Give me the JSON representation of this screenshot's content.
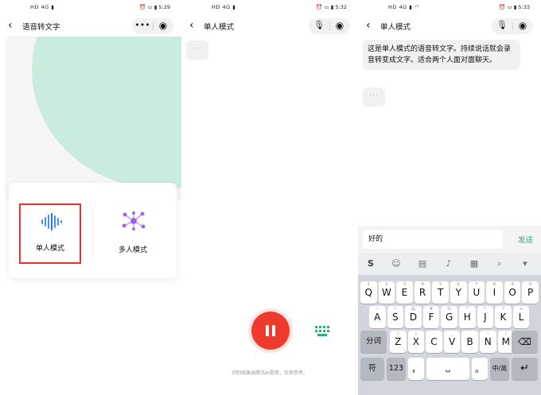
{
  "panels": [
    {
      "status": {
        "left": "HD 4G ▮",
        "right": "⏰ ▭ ▮ 5:29"
      },
      "nav": {
        "title": "语音转文字",
        "back_icon": "chevron-left-icon",
        "more_icon": "more-dots-icon",
        "close_icon": "record-target-icon"
      },
      "modes": [
        {
          "label": "单人模式",
          "icon": "soundwave-icon",
          "selected": true
        },
        {
          "label": "多人模式",
          "icon": "network-nodes-icon",
          "selected": false
        }
      ]
    },
    {
      "status": {
        "left": "HD 4G ▮",
        "right": "⏰ ▭ ▮ 5:32"
      },
      "nav": {
        "title": "单人模式",
        "mic_icon": "microphone-icon",
        "close_icon": "record-target-icon"
      },
      "typing_indicator": "...",
      "pause_button": "pause-icon",
      "keyboard_button": "keyboard-icon",
      "footnote": "识别结果由腾讯AI提供，仅供参考。"
    },
    {
      "status": {
        "left": "HD 4G ▮ ◠",
        "right": "⏰ ▭ ▮ 5:33"
      },
      "nav": {
        "title": "单人模式",
        "mic_icon": "microphone-icon",
        "close_icon": "record-target-icon"
      },
      "message": "这是单人模式的语音转文字。持续说话就会录音转变成文字。适合两个人面对面聊天。",
      "typing_indicator": "...",
      "input": {
        "value": "好的",
        "send_label": "发送"
      },
      "keyboard": {
        "toolbar_icons": [
          "sogou-logo-icon",
          "emoji-icon",
          "clipboard-icon",
          "microphone-icon",
          "apps-grid-icon",
          "search-icon",
          "collapse-icon"
        ],
        "row1": [
          [
            "Q",
            "1"
          ],
          [
            "W",
            "2"
          ],
          [
            "E",
            "3"
          ],
          [
            "R",
            "4"
          ],
          [
            "T",
            "5"
          ],
          [
            "Y",
            "6"
          ],
          [
            "U",
            "7"
          ],
          [
            "I",
            "8"
          ],
          [
            "O",
            "9"
          ],
          [
            "P",
            "0"
          ]
        ],
        "row2": [
          [
            "A",
            "~"
          ],
          [
            "S",
            "!"
          ],
          [
            "D",
            "@"
          ],
          [
            "F",
            "#"
          ],
          [
            "G",
            "%"
          ],
          [
            "H",
            "\""
          ],
          [
            "J",
            "*"
          ],
          [
            "K",
            "?"
          ],
          [
            "L",
            "+"
          ]
        ],
        "row3": [
          [
            "Z",
            "("
          ],
          [
            "X",
            ")"
          ],
          [
            "C",
            "-"
          ],
          [
            "V",
            "_"
          ],
          [
            "B",
            ":"
          ],
          [
            "N",
            ";"
          ],
          [
            "M",
            "/"
          ]
        ],
        "fn_keys": {
          "fenci": "分词",
          "delete": "⌫",
          "symbol": "符",
          "num": "123",
          "comma": "，",
          "space": "␣",
          "period": "。",
          "lang": "中/英",
          "enter": "↵"
        }
      }
    }
  ]
}
